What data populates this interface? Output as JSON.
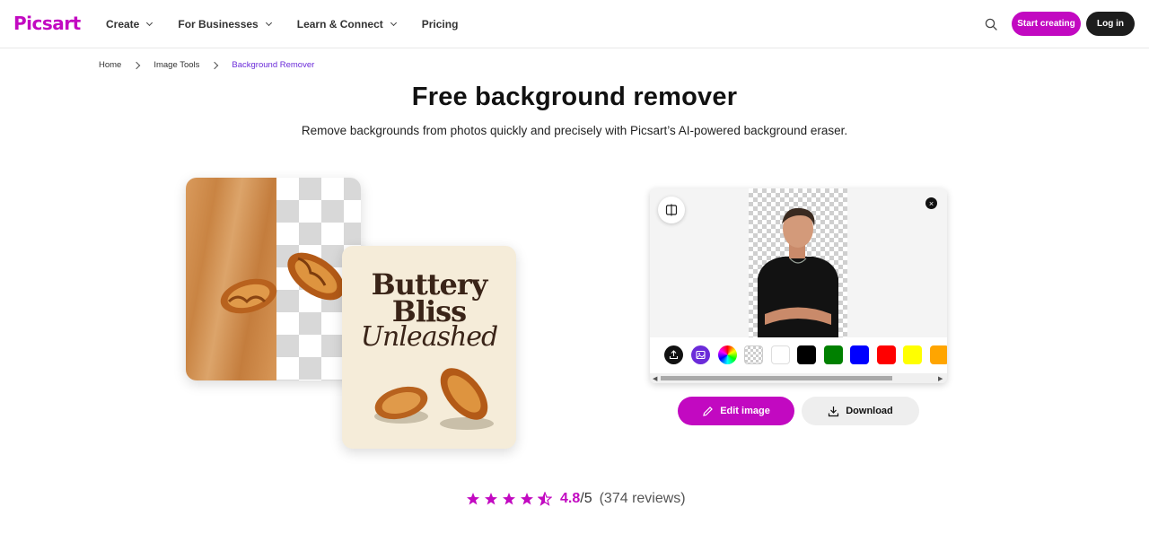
{
  "brand": {
    "logo": "Picsart",
    "accent_color": "#c209c1",
    "dark_color": "#1d1d1d",
    "link_color": "#6b2bd9"
  },
  "nav": {
    "items": [
      {
        "label": "Create",
        "has_dropdown": true
      },
      {
        "label": "For Businesses",
        "has_dropdown": true
      },
      {
        "label": "Learn & Connect",
        "has_dropdown": true
      },
      {
        "label": "Pricing",
        "has_dropdown": false
      }
    ],
    "search_icon": "search-icon",
    "start_label": "Start creating",
    "login_label": "Log in"
  },
  "breadcrumb": [
    "Home",
    "Image Tools",
    "Background Remover"
  ],
  "hero": {
    "title": "Free background remover",
    "subtitle": "Remove backgrounds from photos quickly and precisely with Picsart’s AI-powered background eraser."
  },
  "poster": {
    "line1": "Buttery",
    "line2": "Bliss",
    "line3": "Unleashed"
  },
  "editor": {
    "compare_icon": "compare-icon",
    "close_icon": "close-icon",
    "tools": [
      "upload-icon",
      "image-background-icon",
      "color-wheel-icon",
      "transparent-icon"
    ],
    "swatches": [
      "#ffffff",
      "#000000",
      "#008000",
      "#0000ff",
      "#ff0000",
      "#ffff00",
      "#ffa500"
    ]
  },
  "actions": {
    "edit_label": "Edit image",
    "download_label": "Download"
  },
  "rating": {
    "score": "4.8",
    "max": "/5",
    "reviews": "(374 reviews)",
    "stars": 4.5
  }
}
